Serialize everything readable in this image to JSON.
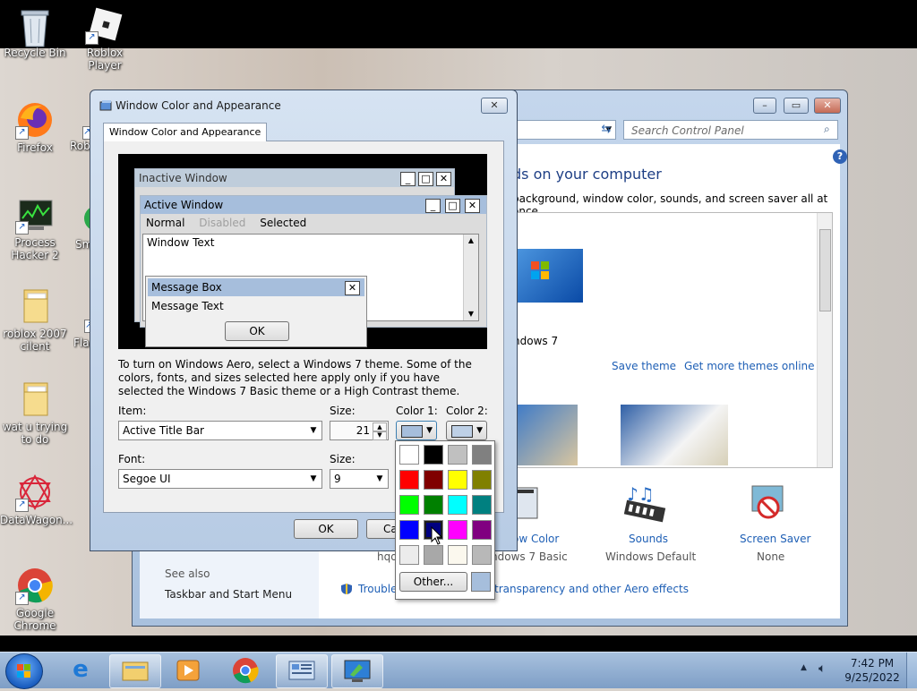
{
  "desktop": {
    "icons": [
      {
        "label": "Recycle Bin"
      },
      {
        "label": "Roblox Player"
      },
      {
        "label": "Firefox"
      },
      {
        "label": "Robl"
      },
      {
        "label": "Process Hacker 2"
      },
      {
        "label": "Sm"
      },
      {
        "label": "roblox 2007 cilent"
      },
      {
        "label": "Fla"
      },
      {
        "label": "wat u trying to do"
      },
      {
        "label": "DataWagon..."
      },
      {
        "label": "Google Chrome"
      }
    ]
  },
  "control_panel": {
    "search_placeholder": "Search Control Panel",
    "heading": "ds on your computer",
    "subheading": "background, window color, sounds, and screen saver all at once.",
    "theme_label": "ndows 7",
    "save_theme": "Save theme",
    "get_more_themes": "Get more themes online",
    "window_color_label": "ow Color",
    "window_color_value": "ndows 7 Basic",
    "sounds_label": "Sounds",
    "sounds_value": "Windows Default",
    "screen_saver_label": "Screen Saver",
    "screen_saver_value": "None",
    "hq_text": "hqd",
    "see_also": "See also",
    "taskbar_link": "Taskbar and Start Menu",
    "trouble_link": "Trouble",
    "aero_link": "transparency and other Aero effects",
    "help": "?"
  },
  "dialog": {
    "title": "Window Color and Appearance",
    "tab": "Window Color and Appearance",
    "preview": {
      "inactive": "Inactive Window",
      "active": "Active Window",
      "menu_normal": "Normal",
      "menu_disabled": "Disabled",
      "menu_selected": "Selected",
      "window_text": "Window Text",
      "message_box": "Message Box",
      "message_text": "Message Text",
      "ok": "OK"
    },
    "info": "To turn on Windows Aero, select a Windows 7 theme.  Some of the colors, fonts, and sizes selected here apply only if you have selected the Windows 7 Basic theme or a High Contrast theme.",
    "item_label": "Item:",
    "item_value": "Active Title Bar",
    "size_label": "Size:",
    "size_value": "21",
    "color1_label": "Color 1:",
    "color2_label": "Color 2:",
    "font_label": "Font:",
    "font_value": "Segoe UI",
    "font_size_label": "Size:",
    "font_size_value": "9",
    "ok": "OK",
    "cancel": "Ca"
  },
  "picker": {
    "swatches": [
      "#ffffff",
      "#000000",
      "#c0c0c0",
      "#808080",
      "#ff0000",
      "#800000",
      "#ffff00",
      "#808000",
      "#00ff00",
      "#008000",
      "#00ffff",
      "#008080",
      "#0000ff",
      "#000080",
      "#ff00ff",
      "#800080",
      "#ececec",
      "#a8a8a8",
      "#fbf8ee",
      "#b8b8b8"
    ],
    "other": "Other...",
    "current_color": "#a6bedc"
  },
  "taskbar": {
    "time": "7:42 PM",
    "date": "9/25/2022"
  }
}
